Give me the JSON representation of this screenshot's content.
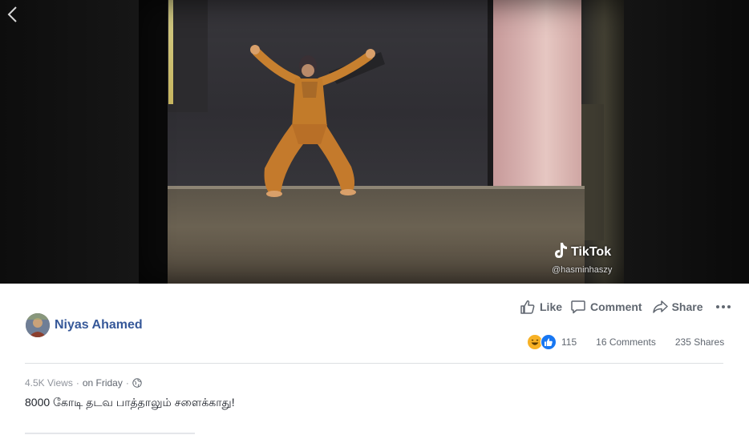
{
  "video": {
    "watermark_brand": "TikTok",
    "watermark_handle": "@hasminhaszy"
  },
  "post": {
    "author_name": "Niyas Ahamed",
    "views": "4.5K Views",
    "meta_separator": "·",
    "date": "on Friday",
    "caption": "8000 கோடி தடவ பாத்தாலும் சளைக்காது!"
  },
  "actions": {
    "like_label": "Like",
    "comment_label": "Comment",
    "share_label": "Share"
  },
  "stats": {
    "reaction_count": "115",
    "comments": "16 Comments",
    "shares": "235 Shares"
  },
  "colors": {
    "author_link": "#365899",
    "action_text": "#606770",
    "meta_text": "#90949c",
    "divider": "#dddfe2",
    "video_background": "#000000"
  },
  "icons": {
    "back": "chevron-left-icon",
    "like": "thumbs-up-icon",
    "comment": "speech-bubble-icon",
    "share": "share-arrow-icon",
    "more": "more-horizontal-icon",
    "privacy": "globe-icon",
    "reaction_1": "haha-reaction-icon",
    "reaction_2": "like-reaction-icon",
    "watermark": "tiktok-logo-icon"
  }
}
